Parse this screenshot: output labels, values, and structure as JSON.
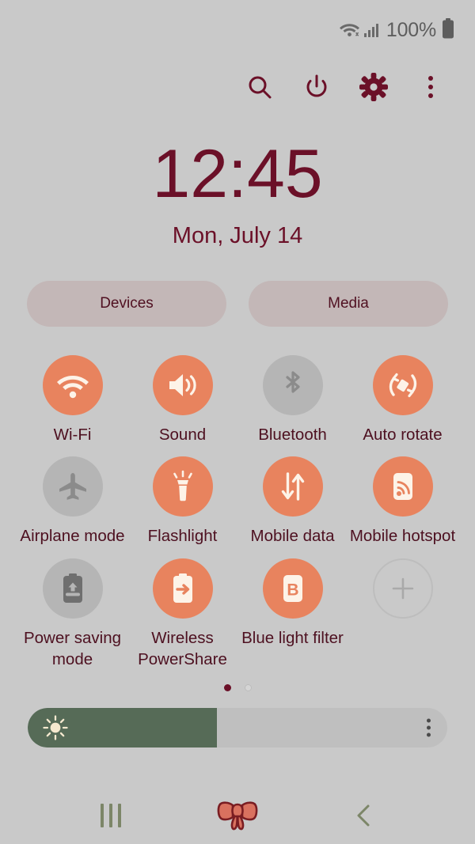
{
  "status_bar": {
    "wifi_icon": "wifi-icon",
    "signal_icon": "cellular-signal-icon",
    "battery_percent": "100%",
    "battery_icon": "battery-full-icon"
  },
  "toolbar": {
    "items": [
      {
        "name": "search-icon",
        "label": "Search"
      },
      {
        "name": "power-icon",
        "label": "Power off"
      },
      {
        "name": "settings-gear-icon",
        "label": "Settings"
      },
      {
        "name": "more-options-icon",
        "label": "More options"
      }
    ]
  },
  "clock": {
    "time": "12:45",
    "date": "Mon, July 14"
  },
  "shortcuts": {
    "devices_label": "Devices",
    "media_label": "Media"
  },
  "quick_settings": {
    "tiles": [
      {
        "label": "Wi-Fi",
        "icon": "wifi-icon",
        "state": "on"
      },
      {
        "label": "Sound",
        "icon": "sound-icon",
        "state": "on"
      },
      {
        "label": "Bluetooth",
        "icon": "bluetooth-icon",
        "state": "off"
      },
      {
        "label": "Auto rotate",
        "icon": "auto-rotate-icon",
        "state": "on"
      },
      {
        "label": "Airplane mode",
        "icon": "airplane-icon",
        "state": "off"
      },
      {
        "label": "Flashlight",
        "icon": "flashlight-icon",
        "state": "on"
      },
      {
        "label": "Mobile data",
        "icon": "mobile-data-icon",
        "state": "on"
      },
      {
        "label": "Mobile hotspot",
        "icon": "mobile-hotspot-icon",
        "state": "on"
      },
      {
        "label": "Power saving mode",
        "icon": "power-saving-icon",
        "state": "off"
      },
      {
        "label": "Wireless PowerShare",
        "icon": "wireless-powershare-icon",
        "state": "on"
      },
      {
        "label": "Blue light filter",
        "icon": "blue-light-filter-icon",
        "state": "on"
      },
      {
        "label": "",
        "icon": "add-tile-icon",
        "state": "add"
      }
    ],
    "pages": 2,
    "active_page": 1
  },
  "brightness": {
    "icon": "brightness-sun-icon",
    "value_percent": 45,
    "menu_icon": "slider-more-options-icon"
  },
  "nav_bar": {
    "recents_icon": "recents-icon",
    "home_icon": "bow-home-icon",
    "back_icon": "back-chevron-icon"
  },
  "colors": {
    "background": "#c9c9c9",
    "accent_on": "#e8835e",
    "accent_off": "#b5b5b5",
    "text_maroon": "#4d1020",
    "clock_maroon": "#6b1028",
    "pill_bg": "#c3b7b7",
    "slider_fill": "#566b57",
    "slider_track": "#bfbfbf",
    "nav_green": "#7c8668",
    "bow_fill": "#d9715f",
    "icon_cream": "#fdf3e8"
  }
}
